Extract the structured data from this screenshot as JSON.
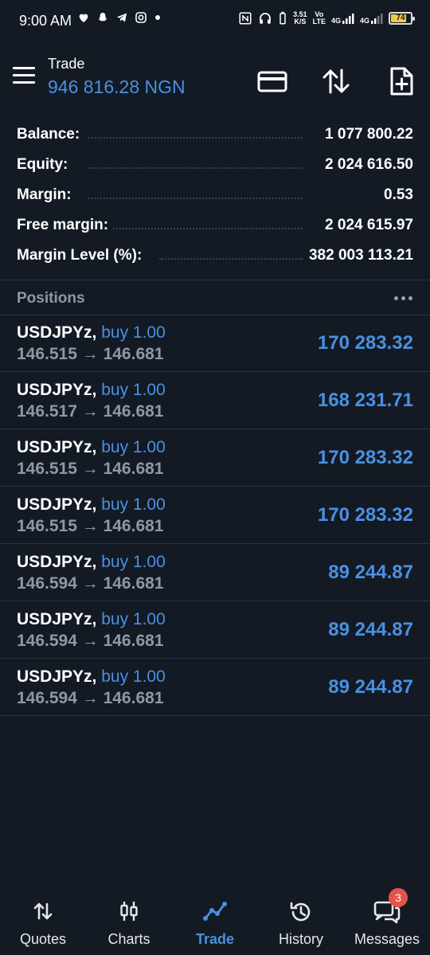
{
  "status_bar": {
    "time": "9:00 AM",
    "net_speed": "3.51",
    "net_unit": "K/S",
    "vo_top": "Vo",
    "vo_bottom": "LTE",
    "net1": "4G",
    "net2": "4G",
    "battery_level": "74",
    "battery_color": "#f2c94c"
  },
  "header": {
    "title": "Trade",
    "balance": "946 816.28 NGN"
  },
  "summary": [
    {
      "label": "Balance:",
      "value": "1 077 800.22"
    },
    {
      "label": "Equity:",
      "value": "2 024 616.50"
    },
    {
      "label": "Margin:",
      "value": "0.53"
    },
    {
      "label": "Free margin:",
      "value": "2 024 615.97"
    },
    {
      "label": "Margin Level (%):",
      "value": "382 003 113.21"
    }
  ],
  "positions": {
    "title": "Positions",
    "rows": [
      {
        "symbol": "USDJPYz,",
        "side": "buy 1.00",
        "prices": "146.515 → 146.681",
        "profit": "170 283.32"
      },
      {
        "symbol": "USDJPYz,",
        "side": "buy 1.00",
        "prices": "146.517 → 146.681",
        "profit": "168 231.71"
      },
      {
        "symbol": "USDJPYz,",
        "side": "buy 1.00",
        "prices": "146.515 → 146.681",
        "profit": "170 283.32"
      },
      {
        "symbol": "USDJPYz,",
        "side": "buy 1.00",
        "prices": "146.515 → 146.681",
        "profit": "170 283.32"
      },
      {
        "symbol": "USDJPYz,",
        "side": "buy 1.00",
        "prices": "146.594 → 146.681",
        "profit": "89 244.87"
      },
      {
        "symbol": "USDJPYz,",
        "side": "buy 1.00",
        "prices": "146.594 → 146.681",
        "profit": "89 244.87"
      },
      {
        "symbol": "USDJPYz,",
        "side": "buy 1.00",
        "prices": "146.594 → 146.681",
        "profit": "89 244.87"
      }
    ]
  },
  "nav": {
    "items": [
      {
        "label": "Quotes",
        "icon": "quotes-arrows-icon"
      },
      {
        "label": "Charts",
        "icon": "candlestick-icon"
      },
      {
        "label": "Trade",
        "icon": "trade-line-icon",
        "active": true
      },
      {
        "label": "History",
        "icon": "history-clock-icon"
      },
      {
        "label": "Messages",
        "icon": "chat-bubbles-icon",
        "badge": "3"
      }
    ]
  },
  "colors": {
    "background": "#131a24",
    "accent": "#4a90e2",
    "muted": "#8e98a6",
    "badge": "#e5534b"
  }
}
